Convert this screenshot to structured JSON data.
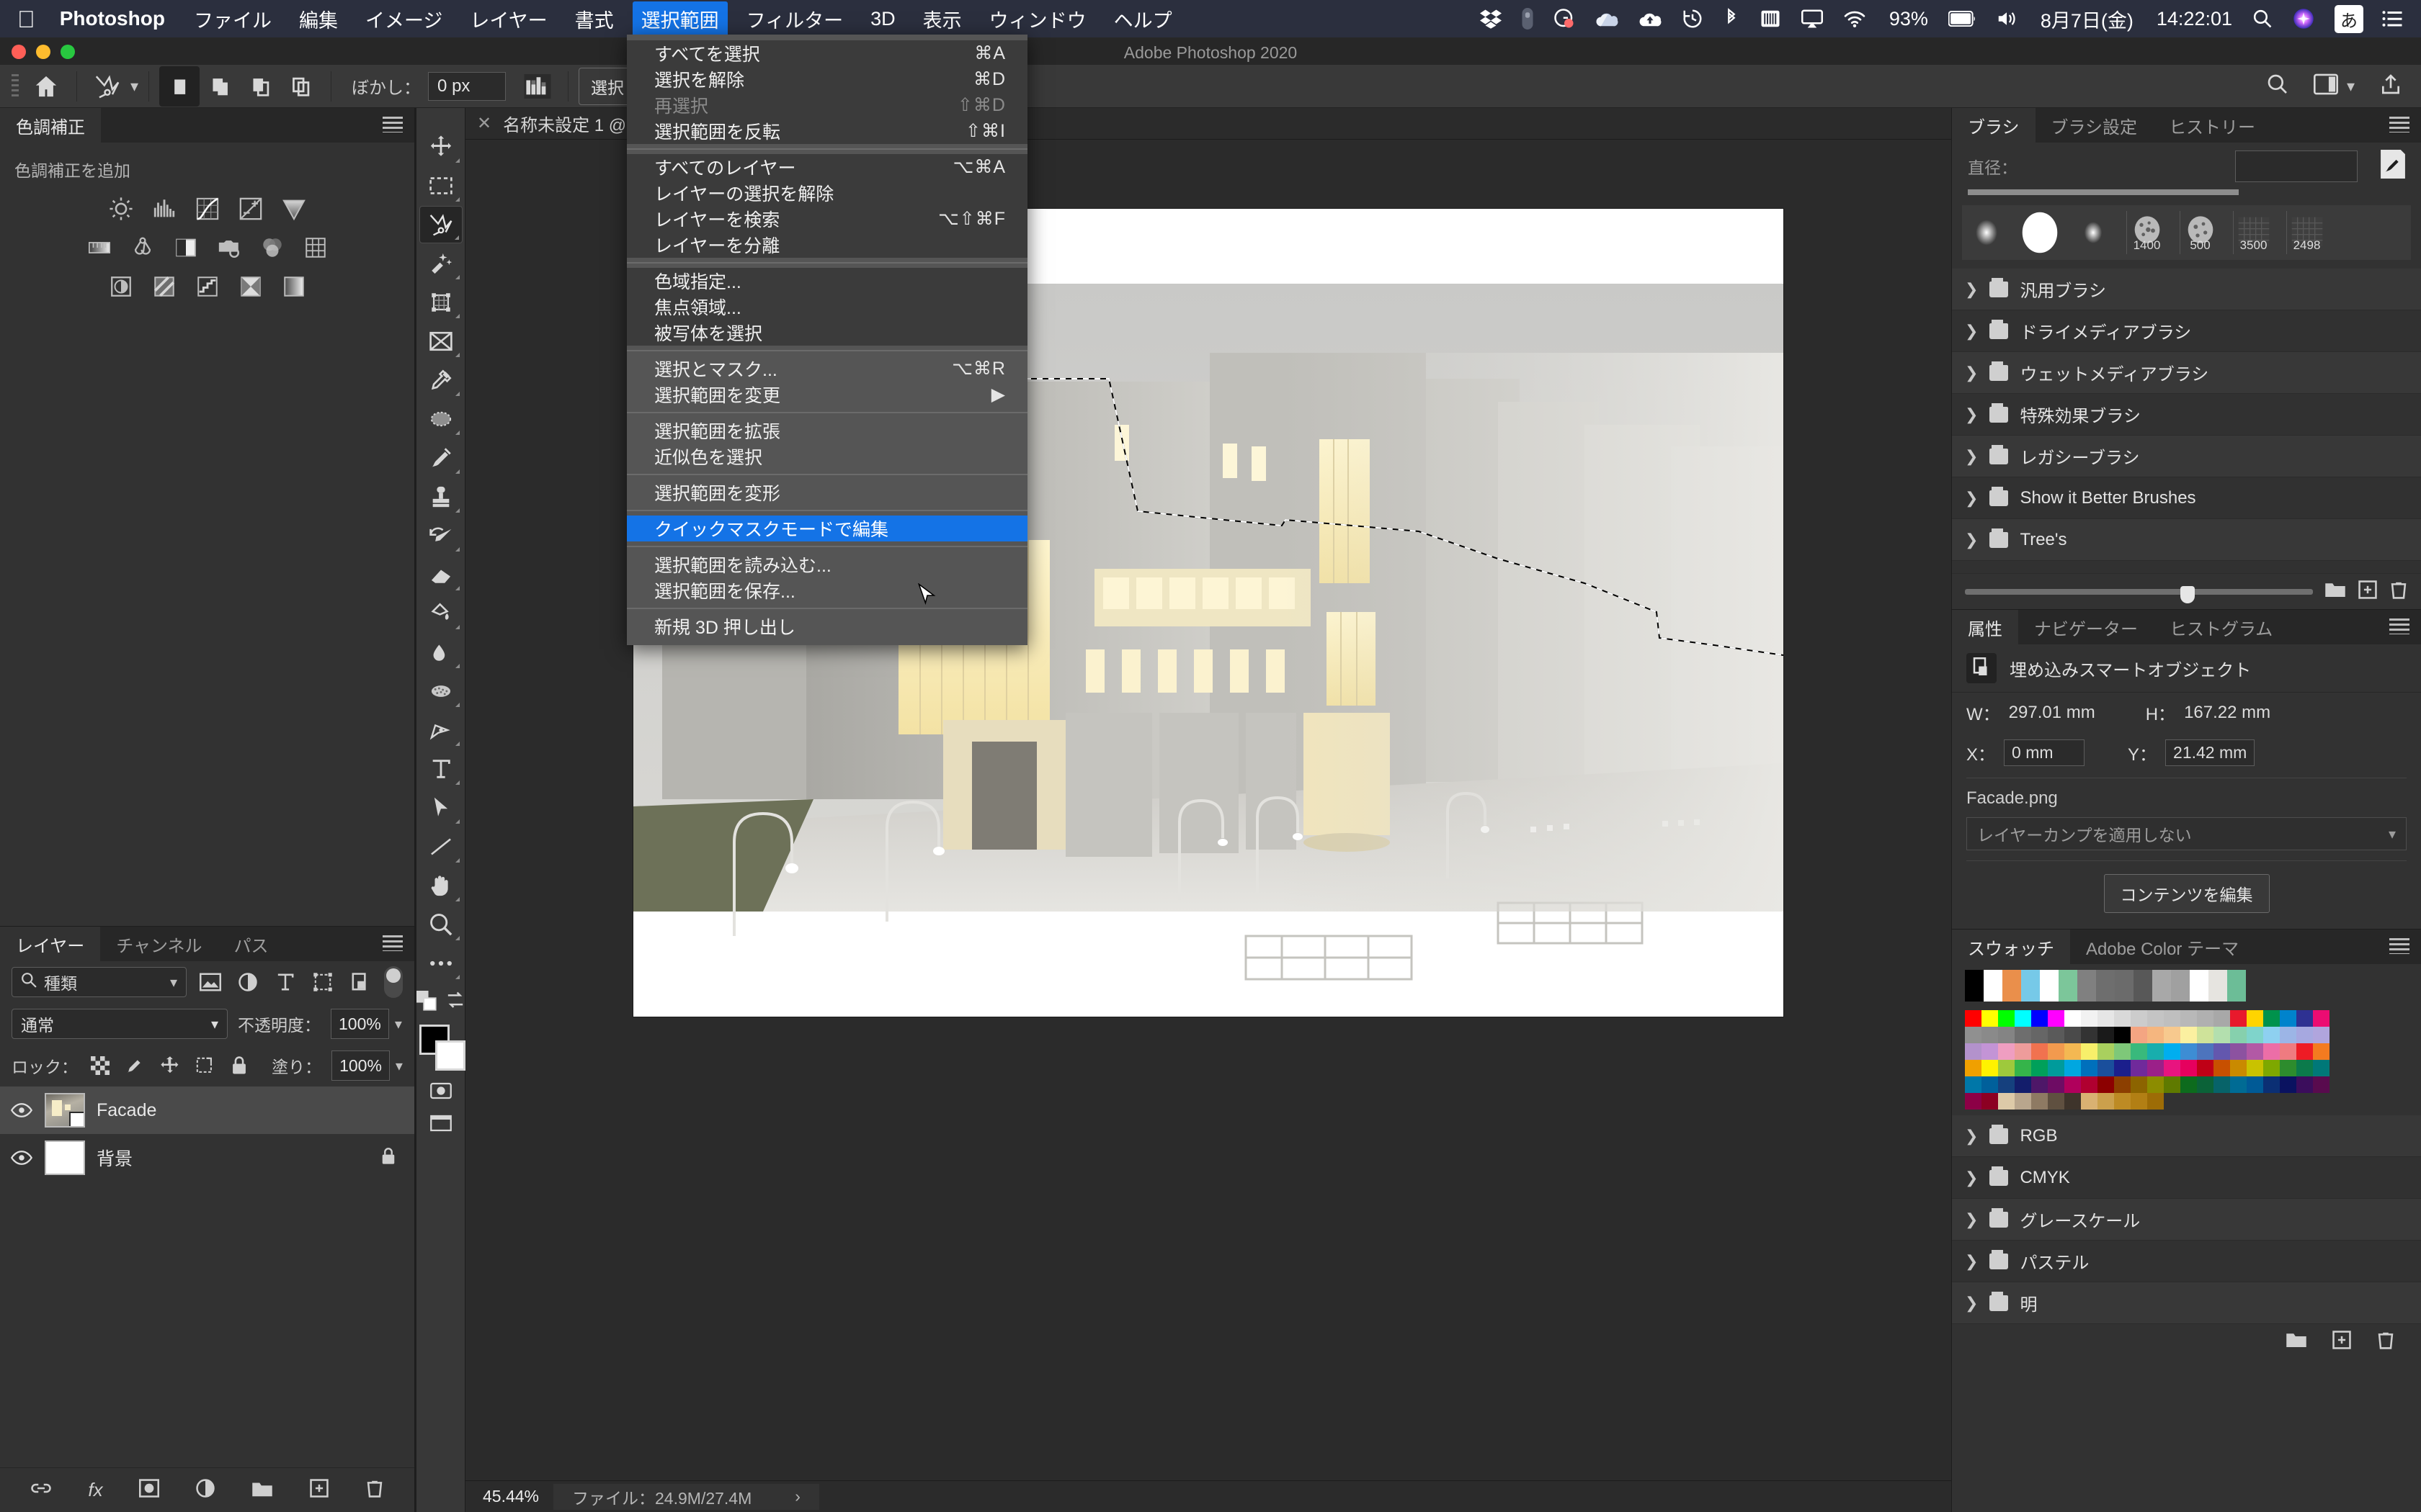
{
  "macos_menubar": {
    "apple_icon": "apple-logo-icon",
    "app_name": "Photoshop",
    "menus": [
      "ファイル",
      "編集",
      "イメージ",
      "レイヤー",
      "書式",
      "選択範囲",
      "フィルター",
      "3D",
      "表示",
      "ウィンドウ",
      "ヘルプ"
    ],
    "active_menu": "選択範囲",
    "status_icons": [
      "dropbox-icon",
      "pill-icon",
      "grammarly-icon",
      "onedrive-icon",
      "cloud-upload-icon",
      "time-machine-icon",
      "bluetooth-icon",
      "battery-pack-icon",
      "airplay-icon",
      "wifi-icon"
    ],
    "battery_percent": "93%",
    "volume_icon": "volume-icon",
    "date": "8月7日(金)",
    "time": "14:22:01",
    "search_icon": "spotlight-search-icon",
    "siri_icon": "siri-icon",
    "ime_label": "あ",
    "notification_icon": "notification-center-icon"
  },
  "window": {
    "title": "Adobe Photoshop 2020"
  },
  "options_bar": {
    "home_icon": "home-icon",
    "tool_icon": "lasso-tool-icon",
    "tool_chevron": "chevron-down-icon",
    "selection_modes": [
      "new-selection-icon",
      "add-to-selection-icon",
      "subtract-from-selection-icon",
      "intersect-selection-icon"
    ],
    "active_mode_index": 0,
    "feather_label": "ぼかし：",
    "feather_value": "0 px",
    "antialias_icon": "anti-alias-icon",
    "select_and_mask_label": "選択とマスク...",
    "search_icon": "search-icon",
    "workspace_icon": "workspace-icon",
    "workspace_chevron": "chevron-down-icon",
    "share_icon": "share-icon"
  },
  "menu_dropdown": {
    "groups": [
      {
        "items": [
          {
            "label": "すべてを選択",
            "shortcut": "⌘A",
            "disabled": false,
            "highlight": false
          },
          {
            "label": "選択を解除",
            "shortcut": "⌘D",
            "disabled": false,
            "highlight": false
          },
          {
            "label": "再選択",
            "shortcut": "⇧⌘D",
            "disabled": true,
            "highlight": false
          },
          {
            "label": "選択範囲を反転",
            "shortcut": "⇧⌘I",
            "disabled": false,
            "highlight": false
          }
        ]
      },
      {
        "items": [
          {
            "label": "すべてのレイヤー",
            "shortcut": "⌥⌘A",
            "disabled": false,
            "highlight": false
          },
          {
            "label": "レイヤーの選択を解除",
            "shortcut": "",
            "disabled": false,
            "highlight": false
          },
          {
            "label": "レイヤーを検索",
            "shortcut": "⌥⇧⌘F",
            "disabled": false,
            "highlight": false
          },
          {
            "label": "レイヤーを分離",
            "shortcut": "",
            "disabled": false,
            "highlight": false
          }
        ]
      },
      {
        "items": [
          {
            "label": "色域指定...",
            "shortcut": "",
            "disabled": false,
            "highlight": false
          },
          {
            "label": "焦点領域...",
            "shortcut": "",
            "disabled": false,
            "highlight": false
          },
          {
            "label": "被写体を選択",
            "shortcut": "",
            "disabled": false,
            "highlight": false
          }
        ]
      },
      {
        "items": [
          {
            "label": "選択とマスク...",
            "shortcut": "⌥⌘R",
            "disabled": false,
            "highlight": false
          },
          {
            "label": "選択範囲を変更",
            "shortcut": "▶",
            "disabled": false,
            "highlight": false
          }
        ]
      },
      {
        "items": [
          {
            "label": "選択範囲を拡張",
            "shortcut": "",
            "disabled": false,
            "highlight": false
          },
          {
            "label": "近似色を選択",
            "shortcut": "",
            "disabled": false,
            "highlight": false
          }
        ]
      },
      {
        "items": [
          {
            "label": "選択範囲を変形",
            "shortcut": "",
            "disabled": false,
            "highlight": false
          }
        ]
      },
      {
        "items": [
          {
            "label": "クイックマスクモードで編集",
            "shortcut": "",
            "disabled": false,
            "highlight": true
          }
        ]
      },
      {
        "items": [
          {
            "label": "選択範囲を読み込む...",
            "shortcut": "",
            "disabled": false,
            "highlight": false
          },
          {
            "label": "選択範囲を保存...",
            "shortcut": "",
            "disabled": false,
            "highlight": false
          }
        ]
      },
      {
        "items": [
          {
            "label": "新規 3D 押し出し",
            "shortcut": "",
            "disabled": false,
            "highlight": false
          }
        ]
      }
    ]
  },
  "left_dock": {
    "adjustments_panel": {
      "tabs": [
        {
          "label": "色調補正",
          "selected": true
        }
      ],
      "add_label": "色調補正を追加",
      "icons_row1": [
        "brightness-contrast-icon",
        "levels-icon",
        "curves-icon",
        "exposure-icon",
        "vibrance-icon"
      ],
      "icons_row2": [
        "hue-saturation-icon",
        "color-balance-icon",
        "black-white-icon",
        "photo-filter-icon",
        "channel-mixer-icon",
        "color-lookup-icon"
      ],
      "icons_row3": [
        "invert-icon",
        "posterize-icon",
        "threshold-icon",
        "gradient-map-icon",
        "selective-color-icon"
      ],
      "menu_icon": "panel-menu-icon"
    },
    "layers_panel": {
      "tabs": [
        {
          "label": "レイヤー",
          "selected": true
        },
        {
          "label": "チャンネル",
          "selected": false
        },
        {
          "label": "パス",
          "selected": false
        }
      ],
      "filter_placeholder": "種類",
      "filter_icons": [
        "pixel-filter-icon",
        "adjustment-filter-icon",
        "type-filter-icon",
        "shape-filter-icon",
        "smartobject-filter-icon"
      ],
      "filter_toggle": "filter-enable-toggle",
      "blend_mode": "通常",
      "opacity_label": "不透明度：",
      "opacity_value": "100%",
      "lock_label": "ロック：",
      "lock_icons": [
        "lock-transparency-icon",
        "lock-image-icon",
        "lock-position-icon",
        "lock-artboard-icon",
        "lock-all-icon"
      ],
      "fill_label": "塗り：",
      "fill_value": "100%",
      "layers": [
        {
          "name": "Facade",
          "visible": true,
          "selected": true,
          "locked": false,
          "thumb": "facade-render"
        },
        {
          "name": "背景",
          "visible": true,
          "selected": false,
          "locked": true,
          "thumb": "white"
        }
      ],
      "footer_icons": [
        "link-layers-icon",
        "layer-fx-icon",
        "layer-mask-icon",
        "adjustment-layer-icon",
        "new-group-icon",
        "new-layer-icon",
        "delete-layer-icon"
      ]
    }
  },
  "toolbar": {
    "tools": [
      {
        "name": "move-tool-icon",
        "selected": false
      },
      {
        "name": "rectangular-marquee-tool-icon",
        "selected": false
      },
      {
        "name": "lasso-tool-icon",
        "selected": true
      },
      {
        "name": "quick-selection-tool-icon",
        "selected": false
      },
      {
        "name": "crop-tool-icon",
        "selected": false
      },
      {
        "name": "frame-tool-icon",
        "selected": false
      },
      {
        "name": "eyedropper-tool-icon",
        "selected": false
      },
      {
        "name": "spot-healing-brush-tool-icon",
        "selected": false
      },
      {
        "name": "brush-tool-icon",
        "selected": false
      },
      {
        "name": "clone-stamp-tool-icon",
        "selected": false
      },
      {
        "name": "history-brush-tool-icon",
        "selected": false
      },
      {
        "name": "eraser-tool-icon",
        "selected": false
      },
      {
        "name": "gradient-tool-icon",
        "selected": false
      },
      {
        "name": "blur-tool-icon",
        "selected": false
      },
      {
        "name": "dodge-tool-icon",
        "selected": false
      },
      {
        "name": "pen-tool-icon",
        "selected": false
      },
      {
        "name": "type-tool-icon",
        "selected": false
      },
      {
        "name": "path-selection-tool-icon",
        "selected": false
      },
      {
        "name": "line-tool-icon",
        "selected": false
      },
      {
        "name": "hand-tool-icon",
        "selected": false
      },
      {
        "name": "zoom-tool-icon",
        "selected": false
      },
      {
        "name": "edit-toolbar-icon",
        "selected": false
      }
    ],
    "default_colors_icon": "default-colors-icon",
    "swap-colors-icon": "swap-colors-icon",
    "foreground_color": "#000000",
    "background_color": "#ffffff"
  },
  "document": {
    "tab_close_icon": "close-icon",
    "tab_name": "名称未設定 1 @",
    "zoom": "45.44%",
    "status_label": "ファイル：24.9M/27.4M",
    "status_chevron": "›"
  },
  "right_dock": {
    "brush_panel": {
      "tabs": [
        {
          "label": "ブラシ",
          "selected": true
        },
        {
          "label": "ブラシ設定",
          "selected": false
        },
        {
          "label": "ヒストリー",
          "selected": false
        }
      ],
      "diameter_label": "直径：",
      "diameter_value": "",
      "brush_editor_icon": "brush-editor-icon",
      "presets": [
        {
          "label": "",
          "type": "soft-small"
        },
        {
          "label": "",
          "type": "hard-round"
        },
        {
          "label": "",
          "type": "soft-small2"
        },
        {
          "label": "1400",
          "type": "textured"
        },
        {
          "label": "500",
          "type": "textured"
        },
        {
          "label": "3500",
          "type": "grid"
        },
        {
          "label": "2498",
          "type": "grid"
        }
      ],
      "groups": [
        "汎用ブラシ",
        "ドライメディアブラシ",
        "ウェットメディアブラシ",
        "特殊効果ブラシ",
        "レガシーブラシ",
        "Show it Better Brushes",
        "Tree's"
      ],
      "footer_icons": [
        "new-group-icon",
        "new-brush-icon",
        "delete-brush-icon"
      ]
    },
    "properties_panel": {
      "tabs": [
        {
          "label": "属性",
          "selected": true
        },
        {
          "label": "ナビゲーター",
          "selected": false
        },
        {
          "label": "ヒストグラム",
          "selected": false
        }
      ],
      "object_icon": "smart-object-icon",
      "object_type": "埋め込みスマートオブジェクト",
      "w_label": "W：",
      "w_value": "297.01 mm",
      "h_label": "H：",
      "h_value": "167.22 mm",
      "x_label": "X：",
      "x_value": "0 mm",
      "y_label": "Y：",
      "y_value": "21.42 mm",
      "file_name": "Facade.png",
      "layer_comp": "レイヤーカンプを適用しない",
      "layer_comp_chevron": "chevron-down-icon",
      "edit_contents_label": "コンテンツを編集"
    },
    "swatches_panel": {
      "tabs": [
        {
          "label": "スウォッチ",
          "selected": true
        },
        {
          "label": "Adobe Color テーマ",
          "selected": false
        }
      ],
      "recent_colors": [
        "#000000",
        "#ffffff",
        "#ea8f4b",
        "#76c9e8",
        "#ffffff",
        "#7cc69a",
        "#808080",
        "#6e6e6e",
        "#6b6b6b",
        "#585858",
        "#a8a8a8",
        "#a0a0a0",
        "#ffffff",
        "#e6e4e0",
        "#6cbd97"
      ],
      "grid_rows": [
        [
          "#ff0000",
          "#ffff00",
          "#00ff00",
          "#00ffff",
          "#0000ff",
          "#ff00ff",
          "#ffffff",
          "#f2f2f2",
          "#e6e6e6",
          "#d9d9d9",
          "#cccccc",
          "#c4c4c4",
          "#bfbfbf",
          "#b8b8b8",
          "#b0b0b0",
          "#a8a8a8",
          "#e8192c",
          "#ffd400",
          "#00924c",
          "#0083cc",
          "#2e3192",
          "#ec0c72"
        ],
        [
          "#909090",
          "#8a8a8a",
          "#848484",
          "#6e6e6e",
          "#666666",
          "#5a5a5a",
          "#4a4a4a",
          "#333333",
          "#1a1a1a",
          "#000000",
          "#f4a582",
          "#f5b67f",
          "#f7c98e",
          "#fbf0a0",
          "#cfe39a",
          "#b3dfae",
          "#86d0ad",
          "#7fd4cb",
          "#8ed0f0",
          "#9cb5e6",
          "#a6a8e0",
          "#b0a5dd"
        ],
        [
          "#b392cc",
          "#c394d6",
          "#ef9ec1",
          "#ee9c9b",
          "#f1724f",
          "#f29a4e",
          "#f4b852",
          "#f7ef6a",
          "#a9d05e",
          "#7ec879",
          "#39b97c",
          "#18aead",
          "#00aeef",
          "#3d8dd4",
          "#4d74bd",
          "#6357ae",
          "#8c52a0",
          "#b259a5",
          "#ec6ea7",
          "#ef7b80",
          "#ee1c25",
          "#f47b20"
        ],
        [
          "#f0a000",
          "#fff200",
          "#9ec93c",
          "#35b44a",
          "#00a05a",
          "#009b9b",
          "#00a7e0",
          "#0070bc",
          "#1a4f9c",
          "#1b1f8c",
          "#702a9b",
          "#9b2089",
          "#e8147f",
          "#e6005e",
          "#bf0016",
          "#c85000",
          "#c98a00",
          "#c9c200",
          "#7ea800",
          "#2d8c2d",
          "#0b7a4b",
          "#007878"
        ],
        [
          "#0077a8",
          "#00609b",
          "#15407e",
          "#131d6b",
          "#4e1768",
          "#6e0c64",
          "#b0005c",
          "#b00030",
          "#8c0000",
          "#8c3f00",
          "#8c6400",
          "#8c8c00",
          "#5f7a00",
          "#0d6b1d",
          "#0b6238",
          "#076369",
          "#006b94",
          "#005a96",
          "#0b2f74",
          "#0a1260",
          "#3b0d5c",
          "#590b4e"
        ],
        [
          "#8c0046",
          "#8c0022",
          "#ddcaa8",
          "#b9a68d",
          "#8e7a63",
          "#5f5040",
          "#3e342b",
          "#d9b172",
          "#cba04c",
          "#bd8b24",
          "#b27f14",
          "#9d6c06"
        ]
      ],
      "groups": [
        "RGB",
        "CMYK",
        "グレースケール",
        "パステル",
        "明"
      ],
      "footer_icons": [
        "new-group-icon",
        "new-swatch-icon",
        "delete-swatch-icon"
      ]
    }
  }
}
